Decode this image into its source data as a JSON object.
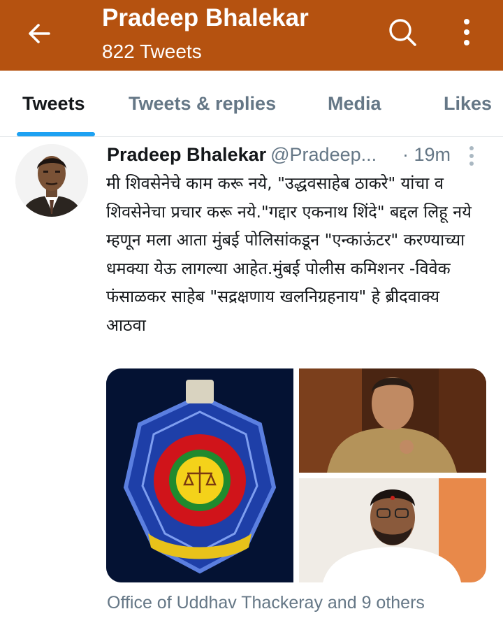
{
  "header": {
    "title": "Pradeep Bhalekar",
    "subtitle": "822 Tweets",
    "background_color": "#b55210",
    "icons": {
      "back": "back-arrow-icon",
      "search": "search-icon",
      "more": "more-vert-icon"
    }
  },
  "tabs": [
    {
      "label": "Tweets",
      "active": true
    },
    {
      "label": "Tweets & replies",
      "active": false
    },
    {
      "label": "Media",
      "active": false
    },
    {
      "label": "Likes",
      "active": false
    }
  ],
  "tweet": {
    "author_name": "Pradeep Bhalekar",
    "handle": "@Pradeep...",
    "time": "· 19m",
    "text": "मी शिवसेनेचे काम करू नये, \"उद्धवसाहेब ठाकरे\" यांचा व शिवसेनेचा प्रचार करू नये.\"गद्दार एकनाथ शिंदे\" बद्दल लिहू नये म्हणून मला आता मुंबई पोलिसांकडून \"एन्काऊंटर\" करण्याच्या धमक्या येऊ लागल्या आहेत.मुंबई पोलीस कमिशनर -विवेक फंसाळकर साहेब \"सद्रक्षणाय खलनिग्रहनाय\" हे ब्रीदवाक्य आठवा",
    "social_context": "Office of Uddhav Thackeray and 9 others"
  },
  "colors": {
    "accent": "#1da1f2",
    "secondary_text": "#657786",
    "primary_text": "#14171a"
  }
}
